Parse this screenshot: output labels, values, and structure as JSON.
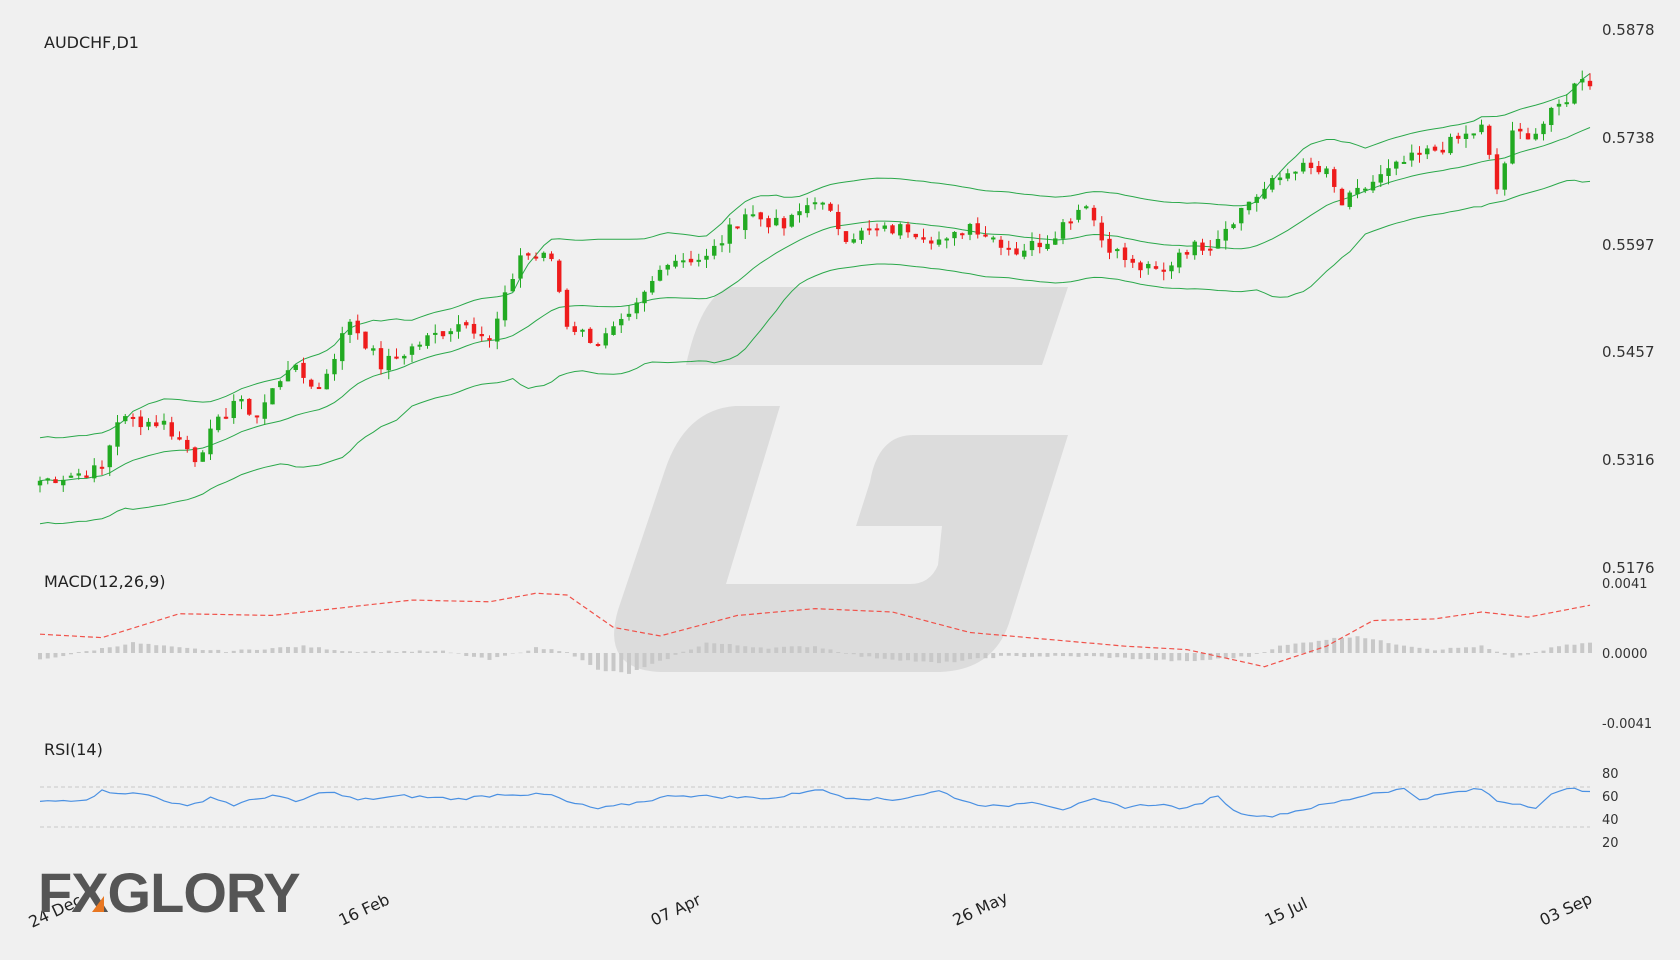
{
  "colors": {
    "background": "#f0f0f0",
    "up": "#22aa22",
    "down": "#ee1c1c",
    "band": "#2aa84a",
    "macd_signal": "#f0524a",
    "macd_hist": "#c8c8c8",
    "rsi": "#4a90e2",
    "watermark": "#dcdcdc",
    "logo_text": "#555555",
    "logo_accent": "#e87722"
  },
  "logo": {
    "text": "FXGLORY"
  },
  "chart_data": [
    {
      "type": "candlestick",
      "title": "AUDCHF,D1",
      "ylim": [
        0.5176,
        0.5878
      ],
      "yticks": [
        "0.5878",
        "0.5738",
        "0.5597",
        "0.5457",
        "0.5316",
        "0.5176"
      ],
      "xticks": [
        "24 Dec",
        "16 Feb",
        "07 Apr",
        "26 May",
        "15 Jul",
        "03 Sep"
      ],
      "overlays": [
        "bollinger_upper",
        "bollinger_middle",
        "bollinger_lower"
      ],
      "anchors": [
        {
          "i": 0,
          "c": 0.529
        },
        {
          "i": 8,
          "c": 0.5305
        },
        {
          "i": 10,
          "c": 0.537
        },
        {
          "i": 16,
          "c": 0.5365
        },
        {
          "i": 20,
          "c": 0.532
        },
        {
          "i": 25,
          "c": 0.5395
        },
        {
          "i": 28,
          "c": 0.5375
        },
        {
          "i": 32,
          "c": 0.544
        },
        {
          "i": 36,
          "c": 0.541
        },
        {
          "i": 40,
          "c": 0.55
        },
        {
          "i": 44,
          "c": 0.544
        },
        {
          "i": 50,
          "c": 0.5475
        },
        {
          "i": 55,
          "c": 0.55
        },
        {
          "i": 58,
          "c": 0.547
        },
        {
          "i": 62,
          "c": 0.5585
        },
        {
          "i": 66,
          "c": 0.558
        },
        {
          "i": 68,
          "c": 0.5495
        },
        {
          "i": 72,
          "c": 0.547
        },
        {
          "i": 76,
          "c": 0.55
        },
        {
          "i": 81,
          "c": 0.558
        },
        {
          "i": 86,
          "c": 0.558
        },
        {
          "i": 91,
          "c": 0.564
        },
        {
          "i": 96,
          "c": 0.562
        },
        {
          "i": 100,
          "c": 0.566
        },
        {
          "i": 104,
          "c": 0.561
        },
        {
          "i": 112,
          "c": 0.562
        },
        {
          "i": 117,
          "c": 0.56
        },
        {
          "i": 120,
          "c": 0.5625
        },
        {
          "i": 126,
          "c": 0.559
        },
        {
          "i": 130,
          "c": 0.5605
        },
        {
          "i": 135,
          "c": 0.5655
        },
        {
          "i": 137,
          "c": 0.5605
        },
        {
          "i": 141,
          "c": 0.557
        },
        {
          "i": 145,
          "c": 0.556
        },
        {
          "i": 147,
          "c": 0.559
        },
        {
          "i": 151,
          "c": 0.56
        },
        {
          "i": 156,
          "c": 0.5655
        },
        {
          "i": 162,
          "c": 0.57
        },
        {
          "i": 166,
          "c": 0.569
        },
        {
          "i": 168,
          "c": 0.565
        },
        {
          "i": 172,
          "c": 0.568
        },
        {
          "i": 176,
          "c": 0.5705
        },
        {
          "i": 182,
          "c": 0.573
        },
        {
          "i": 186,
          "c": 0.575
        },
        {
          "i": 188,
          "c": 0.567
        },
        {
          "i": 190,
          "c": 0.574
        },
        {
          "i": 193,
          "c": 0.5745
        },
        {
          "i": 197,
          "c": 0.579
        },
        {
          "i": 199,
          "c": 0.582
        },
        {
          "i": 200,
          "c": 0.581
        }
      ]
    },
    {
      "type": "line",
      "title": "MACD(12,26,9)",
      "ylim": [
        -0.0041,
        0.0041
      ],
      "yticks": [
        "0.0041",
        "0.0000",
        "-0.0041"
      ],
      "series": [
        {
          "name": "signal",
          "points": [
            {
              "i": 0,
              "v": 0.0011
            },
            {
              "i": 8,
              "v": 0.0009
            },
            {
              "i": 18,
              "v": 0.0023
            },
            {
              "i": 30,
              "v": 0.0022
            },
            {
              "i": 38,
              "v": 0.0026
            },
            {
              "i": 48,
              "v": 0.0031
            },
            {
              "i": 58,
              "v": 0.003
            },
            {
              "i": 64,
              "v": 0.0035
            },
            {
              "i": 68,
              "v": 0.0034
            },
            {
              "i": 74,
              "v": 0.0015
            },
            {
              "i": 80,
              "v": 0.001
            },
            {
              "i": 90,
              "v": 0.0022
            },
            {
              "i": 100,
              "v": 0.0026
            },
            {
              "i": 110,
              "v": 0.0024
            },
            {
              "i": 120,
              "v": 0.0012
            },
            {
              "i": 130,
              "v": 0.0008
            },
            {
              "i": 140,
              "v": 0.0004
            },
            {
              "i": 148,
              "v": 0.0002
            },
            {
              "i": 158,
              "v": -0.0008
            },
            {
              "i": 166,
              "v": 0.0004
            },
            {
              "i": 172,
              "v": 0.0019
            },
            {
              "i": 180,
              "v": 0.002
            },
            {
              "i": 186,
              "v": 0.0024
            },
            {
              "i": 192,
              "v": 0.0021
            },
            {
              "i": 200,
              "v": 0.0028
            }
          ]
        },
        {
          "name": "histogram",
          "points": [
            {
              "i": 0,
              "v": -0.0004
            },
            {
              "i": 6,
              "v": 0.0001
            },
            {
              "i": 12,
              "v": 0.0006
            },
            {
              "i": 18,
              "v": 0.0003
            },
            {
              "i": 24,
              "v": 0.0001
            },
            {
              "i": 34,
              "v": 0.0004
            },
            {
              "i": 40,
              "v": 0.0001
            },
            {
              "i": 52,
              "v": 0.0001
            },
            {
              "i": 58,
              "v": -0.0004
            },
            {
              "i": 64,
              "v": 0.0003
            },
            {
              "i": 68,
              "v": 0.0001
            },
            {
              "i": 72,
              "v": -0.001
            },
            {
              "i": 76,
              "v": -0.0012
            },
            {
              "i": 80,
              "v": -0.0005
            },
            {
              "i": 86,
              "v": 0.0006
            },
            {
              "i": 94,
              "v": 0.0003
            },
            {
              "i": 100,
              "v": 0.0004
            },
            {
              "i": 106,
              "v": -0.0002
            },
            {
              "i": 116,
              "v": -0.0006
            },
            {
              "i": 124,
              "v": -0.0002
            },
            {
              "i": 136,
              "v": -0.0002
            },
            {
              "i": 148,
              "v": -0.0005
            },
            {
              "i": 156,
              "v": -0.0002
            },
            {
              "i": 160,
              "v": 0.0004
            },
            {
              "i": 166,
              "v": 0.0008
            },
            {
              "i": 170,
              "v": 0.001
            },
            {
              "i": 174,
              "v": 0.0006
            },
            {
              "i": 180,
              "v": 0.0002
            },
            {
              "i": 186,
              "v": 0.0004
            },
            {
              "i": 190,
              "v": -0.0003
            },
            {
              "i": 196,
              "v": 0.0004
            },
            {
              "i": 200,
              "v": 0.0006
            }
          ]
        }
      ]
    },
    {
      "type": "line",
      "title": "RSI(14)",
      "ylim": [
        15,
        85
      ],
      "yticks": [
        "80",
        "60",
        "40",
        "20"
      ],
      "levels": [
        70,
        30
      ],
      "series": [
        {
          "name": "RSI",
          "points": [
            {
              "i": 0,
              "v": 55
            },
            {
              "i": 6,
              "v": 58
            },
            {
              "i": 8,
              "v": 66
            },
            {
              "i": 14,
              "v": 62
            },
            {
              "i": 19,
              "v": 50
            },
            {
              "i": 22,
              "v": 60
            },
            {
              "i": 25,
              "v": 52
            },
            {
              "i": 30,
              "v": 62
            },
            {
              "i": 33,
              "v": 55
            },
            {
              "i": 37,
              "v": 66
            },
            {
              "i": 41,
              "v": 57
            },
            {
              "i": 47,
              "v": 61
            },
            {
              "i": 54,
              "v": 58
            },
            {
              "i": 60,
              "v": 63
            },
            {
              "i": 66,
              "v": 62
            },
            {
              "i": 68,
              "v": 55
            },
            {
              "i": 72,
              "v": 48
            },
            {
              "i": 76,
              "v": 53
            },
            {
              "i": 82,
              "v": 62
            },
            {
              "i": 88,
              "v": 60
            },
            {
              "i": 95,
              "v": 59
            },
            {
              "i": 100,
              "v": 68
            },
            {
              "i": 104,
              "v": 60
            },
            {
              "i": 110,
              "v": 57
            },
            {
              "i": 116,
              "v": 66
            },
            {
              "i": 120,
              "v": 54
            },
            {
              "i": 124,
              "v": 50
            },
            {
              "i": 128,
              "v": 56
            },
            {
              "i": 132,
              "v": 48
            },
            {
              "i": 136,
              "v": 57
            },
            {
              "i": 140,
              "v": 50
            },
            {
              "i": 144,
              "v": 53
            },
            {
              "i": 148,
              "v": 48
            },
            {
              "i": 152,
              "v": 62
            },
            {
              "i": 154,
              "v": 46
            },
            {
              "i": 158,
              "v": 40
            },
            {
              "i": 162,
              "v": 46
            },
            {
              "i": 168,
              "v": 56
            },
            {
              "i": 172,
              "v": 64
            },
            {
              "i": 176,
              "v": 68
            },
            {
              "i": 178,
              "v": 58
            },
            {
              "i": 182,
              "v": 64
            },
            {
              "i": 186,
              "v": 68
            },
            {
              "i": 188,
              "v": 56
            },
            {
              "i": 191,
              "v": 53
            },
            {
              "i": 193,
              "v": 50
            },
            {
              "i": 195,
              "v": 62
            },
            {
              "i": 198,
              "v": 70
            },
            {
              "i": 200,
              "v": 64
            }
          ]
        }
      ]
    }
  ]
}
